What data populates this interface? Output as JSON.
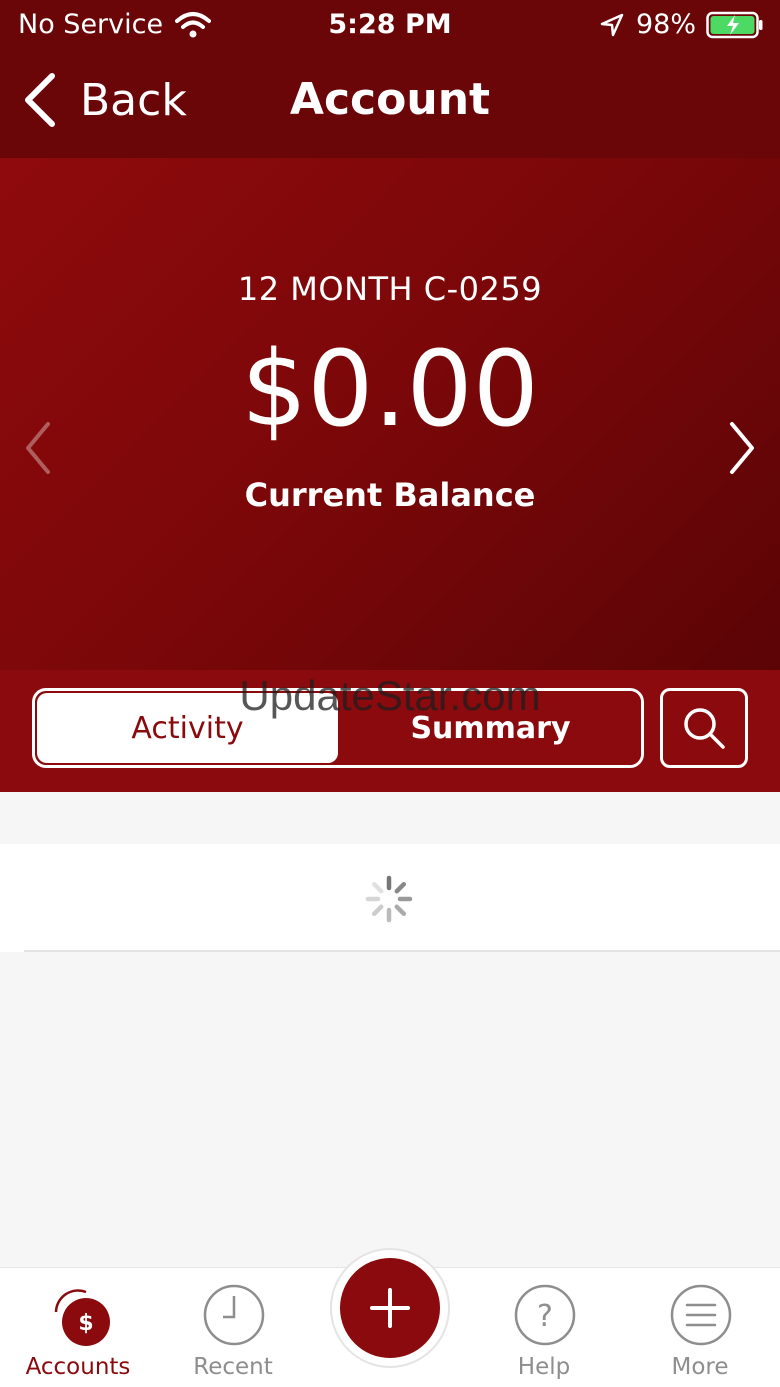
{
  "status_bar": {
    "carrier": "No Service",
    "time": "5:28 PM",
    "battery": "98%"
  },
  "nav": {
    "back_label": "Back",
    "title": "Account"
  },
  "account": {
    "name": "12 MONTH C-0259",
    "balance": "$0.00",
    "balance_label": "Current Balance"
  },
  "segments": {
    "activity": "Activity",
    "summary": "Summary"
  },
  "watermark": "UpdateStar.com",
  "tab_bar": {
    "items": [
      {
        "label": "Accounts",
        "icon": "accounts-icon",
        "glyph": "$"
      },
      {
        "label": "Recent",
        "icon": "clock-icon"
      },
      {
        "label": "Help",
        "icon": "help-icon",
        "glyph": "?"
      },
      {
        "label": "More",
        "icon": "menu-icon"
      }
    ],
    "fab_icon": "plus-icon"
  },
  "colors": {
    "brand": "#8a0a0d",
    "header": "#6a0508",
    "battery_fill": "#4cd964"
  }
}
